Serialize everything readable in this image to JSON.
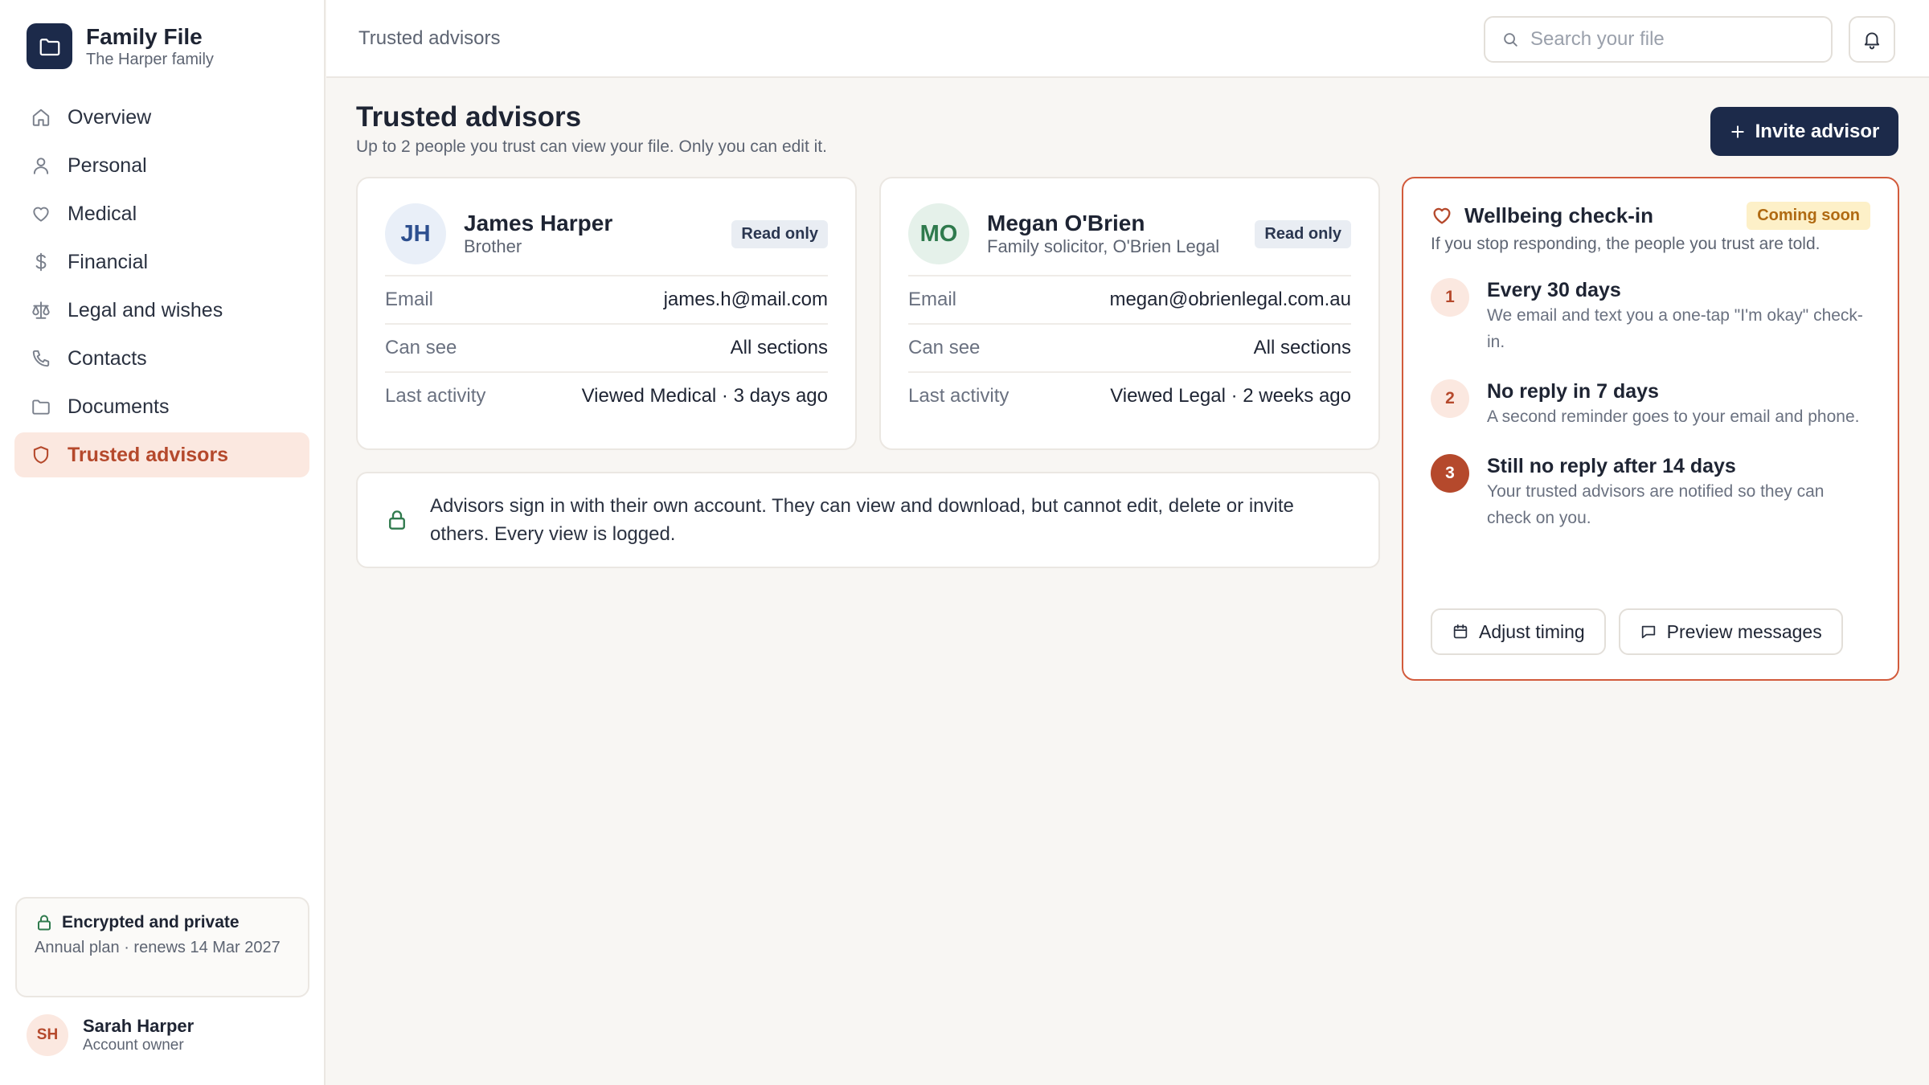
{
  "brand": {
    "title": "Family File",
    "subtitle": "The Harper family"
  },
  "sidebar": {
    "items": [
      {
        "label": "Overview",
        "icon": "home-icon"
      },
      {
        "label": "Personal",
        "icon": "user-icon"
      },
      {
        "label": "Medical",
        "icon": "heart-icon"
      },
      {
        "label": "Financial",
        "icon": "dollar-icon"
      },
      {
        "label": "Legal and wishes",
        "icon": "scales-icon"
      },
      {
        "label": "Contacts",
        "icon": "phone-icon"
      },
      {
        "label": "Documents",
        "icon": "folder-icon"
      },
      {
        "label": "Trusted advisors",
        "icon": "shield-icon",
        "active": true
      }
    ],
    "security": {
      "title": "Encrypted and private",
      "subtitle": "Annual plan · renews 14 Mar 2027"
    },
    "user": {
      "initials": "SH",
      "name": "Sarah Harper",
      "role": "Account owner"
    }
  },
  "topbar": {
    "breadcrumb": "Trusted advisors",
    "search_placeholder": "Search your file"
  },
  "main": {
    "title": "Trusted advisors",
    "subtitle": "Up to 2 people you trust can view your file. Only you can edit it.",
    "invite_label": "Invite advisor",
    "advisors": [
      {
        "initials": "JH",
        "name": "James Harper",
        "relation": "Brother",
        "badge": "Read only",
        "rows": [
          {
            "label": "Email",
            "value": "james.h@mail.com"
          },
          {
            "label": "Can see",
            "value": "All sections"
          },
          {
            "label": "Last activity",
            "value": "Viewed Medical · 3 days ago"
          }
        ]
      },
      {
        "initials": "MO",
        "name": "Megan O'Brien",
        "relation": "Family solicitor, O'Brien Legal",
        "badge": "Read only",
        "rows": [
          {
            "label": "Email",
            "value": "megan@obrienlegal.com.au"
          },
          {
            "label": "Can see",
            "value": "All sections"
          },
          {
            "label": "Last activity",
            "value": "Viewed Legal · 2 weeks ago"
          }
        ]
      }
    ],
    "note": "Advisors sign in with their own account. They can view and download, but cannot edit, delete or invite others. Every view is logged."
  },
  "wellbeing": {
    "title": "Wellbeing check-in",
    "badge": "Coming soon",
    "subtitle": "If you stop responding, the people you trust are told.",
    "steps": [
      {
        "num": "1",
        "title": "Every 30 days",
        "desc": "We email and text you a one-tap \"I'm okay\" check-in."
      },
      {
        "num": "2",
        "title": "No reply in 7 days",
        "desc": "A second reminder goes to your email and phone."
      },
      {
        "num": "3",
        "title": "Still no reply after 14 days",
        "desc": "Your trusted advisors are notified so they can check on you."
      }
    ],
    "adjust_label": "Adjust timing",
    "preview_label": "Preview messages"
  },
  "colors": {
    "navy": "#1c2a4a",
    "accent": "#b5492c",
    "accent_light": "#fbe8e0",
    "badge_yellow": "#fdf0c8",
    "green": "#2f7a4d"
  }
}
